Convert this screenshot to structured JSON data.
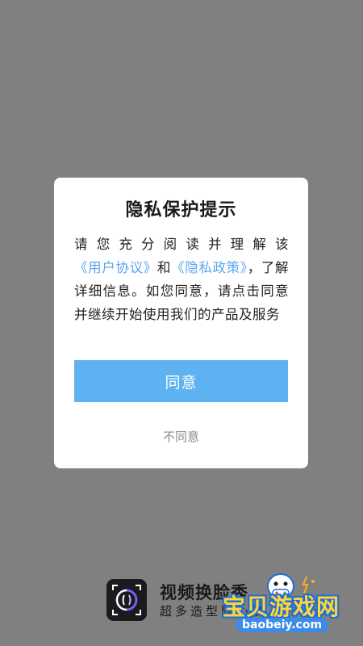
{
  "dialog": {
    "title": "隐私保护提示",
    "body_prefix": "请您充分阅读并理解该",
    "user_agreement_link": "《用户协议》",
    "body_and": "和",
    "privacy_policy_link": "《隐私政策》",
    "body_suffix": "，了解详细信息。如您同意，请点击同意并继续开始使用我们的产品及服务",
    "agree_label": "同意",
    "disagree_label": "不同意"
  },
  "footer": {
    "app_name": "视频换脸秀",
    "app_slogan": "超多造型随心换"
  },
  "watermark": {
    "title": "宝贝游戏网",
    "url": "baobeiy.com"
  },
  "colors": {
    "overlay": "#808080",
    "link": "#5aa6f0",
    "agree_button": "#5eb2f2",
    "disagree_text": "#8a8a8a"
  }
}
